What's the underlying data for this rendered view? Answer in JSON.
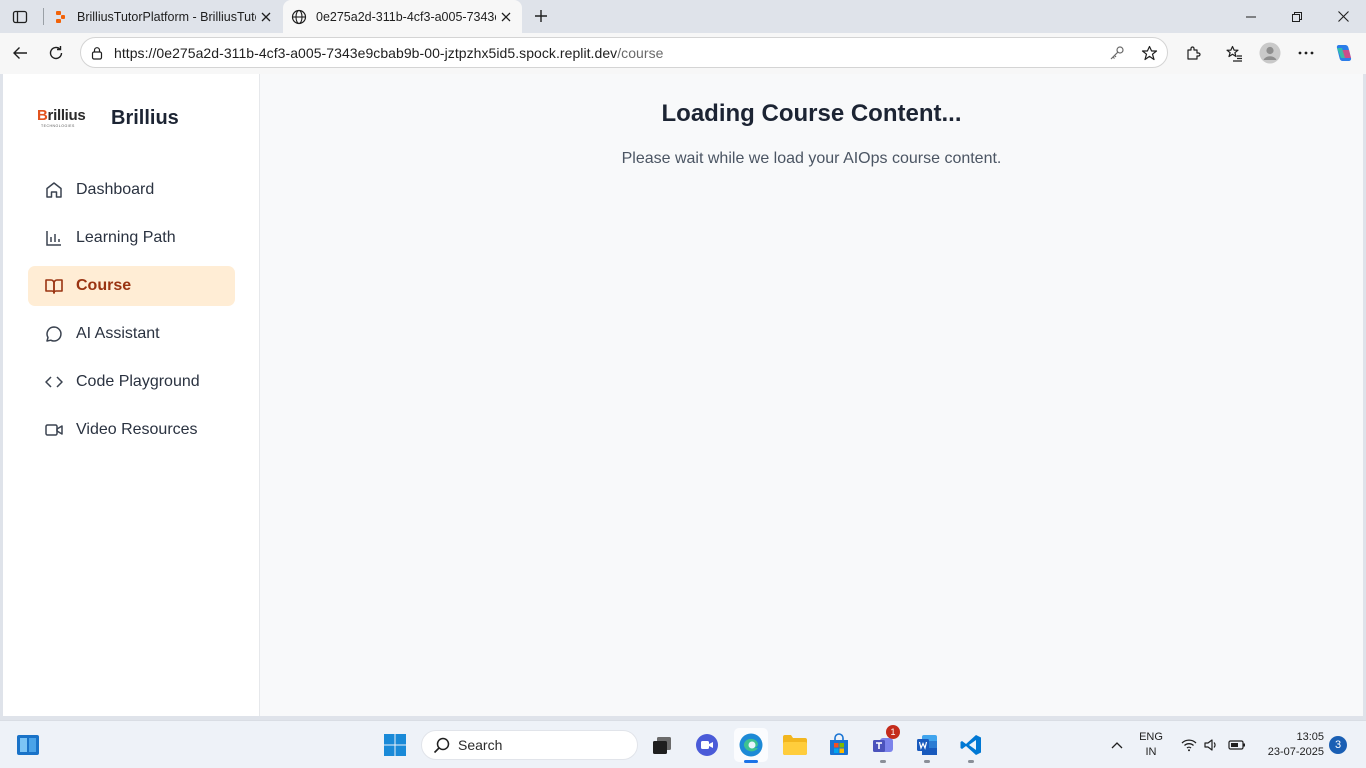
{
  "browser": {
    "tabs": [
      {
        "title": "BrilliusTutorPlatform - BrilliusTuto",
        "active": false
      },
      {
        "title": "0e275a2d-311b-4cf3-a005-7343e",
        "active": true
      }
    ],
    "url_host": "https://0e275a2d-311b-4cf3-a005-7343e9cbab9b-00-jztpzhx5id5.spock.replit.dev",
    "url_path": "/course"
  },
  "sidebar": {
    "logo_text_b": "B",
    "logo_text_rest": "rillius",
    "logo_subtext": "TECHNOLOGIES",
    "brand_name": "Brillius",
    "items": [
      {
        "label": "Dashboard",
        "icon": "home-icon",
        "active": false
      },
      {
        "label": "Learning Path",
        "icon": "bar-chart-icon",
        "active": false
      },
      {
        "label": "Course",
        "icon": "book-open-icon",
        "active": true
      },
      {
        "label": "AI Assistant",
        "icon": "chat-bubble-icon",
        "active": false
      },
      {
        "label": "Code Playground",
        "icon": "code-icon",
        "active": false
      },
      {
        "label": "Video Resources",
        "icon": "video-icon",
        "active": false
      }
    ]
  },
  "main": {
    "title": "Loading Course Content...",
    "message": "Please wait while we load your AIOps course content."
  },
  "taskbar": {
    "search_placeholder": "Search",
    "teams_badge": "1",
    "language_line1": "ENG",
    "language_line2": "IN",
    "time": "13:05",
    "date": "23-07-2025",
    "notification_count": "3"
  },
  "colors": {
    "accent_orange": "#9a3412",
    "active_nav_bg": "#ffedd5",
    "page_bg": "#f8f9fa"
  }
}
